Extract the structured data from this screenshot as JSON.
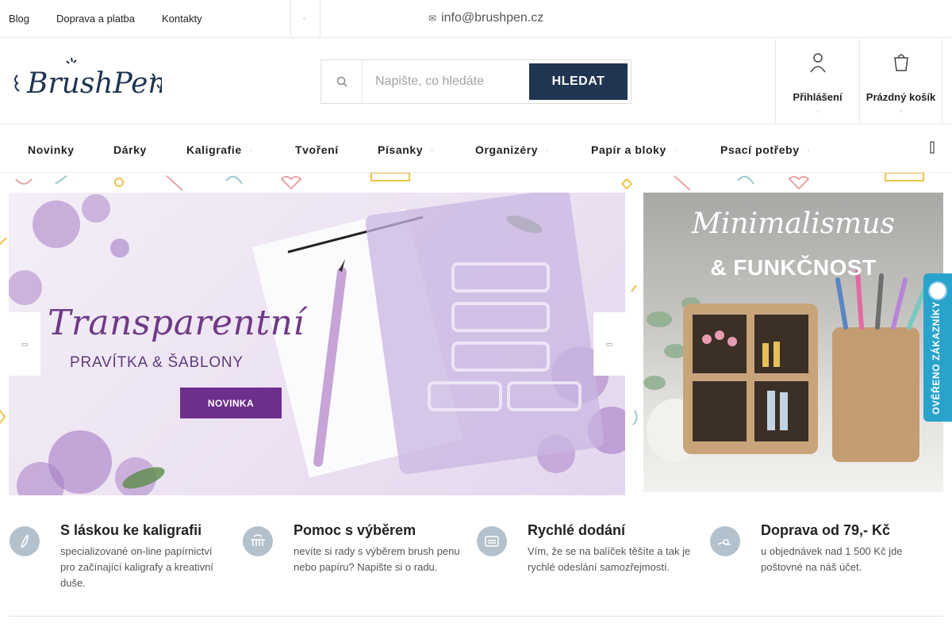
{
  "topbar": {
    "links": [
      "Blog",
      "Doprava a platba",
      "Kontakty"
    ],
    "email": "info@brushpen.cz"
  },
  "header": {
    "logo_text": "BrushPen",
    "search_placeholder": "Napište, co hledáte",
    "search_button": "HLEDAT",
    "login_label": "Přihlášení",
    "cart_label": "Prázdný košík"
  },
  "nav": {
    "items": [
      {
        "label": "Novinky",
        "has_submenu": false
      },
      {
        "label": "Dárky",
        "has_submenu": false
      },
      {
        "label": "Kaligrafie",
        "has_submenu": true
      },
      {
        "label": "Tvoření",
        "has_submenu": false
      },
      {
        "label": "Písanky",
        "has_submenu": true
      },
      {
        "label": "Organizéry",
        "has_submenu": true
      },
      {
        "label": "Papír a bloky",
        "has_submenu": true
      },
      {
        "label": "Psací potřeby",
        "has_submenu": true
      }
    ]
  },
  "banner_main": {
    "title": "Transparentní",
    "subtitle": "PRAVÍTKA & ŠABLONY",
    "button": "NOVINKA"
  },
  "banner_side": {
    "title": "Minimalismus",
    "subtitle": "& FUNKČNOST"
  },
  "badge": {
    "text": "OVĚŘENO ZÁKAZNÍKY"
  },
  "features": [
    {
      "icon": "pen-nib-icon",
      "title": "S láskou ke kaligrafii",
      "text": "specializované on-line papírnictví pro začínající kaligrafy a kreativní duše."
    },
    {
      "icon": "helping-hand-icon",
      "title": "Pomoc s výběrem",
      "text": "nevíte si rady s výběrem brush penu nebo papíru? Napište si o radu."
    },
    {
      "icon": "delivery-truck-icon",
      "title": "Rychlé dodání",
      "text": "Vím, že se na balíček těšíte a tak je rychlé odeslání samozřejmostí."
    },
    {
      "icon": "money-hand-icon",
      "title": "Doprava od 79,- Kč",
      "text": "u objednávek nad 1 500 Kč jde poštovné na náš účet."
    }
  ],
  "colors": {
    "primary_button": "#1f3551",
    "accent_purple": "#6e2f8c",
    "badge_blue": "#2aa3cc",
    "feature_icon_bg": "#b3c1cc"
  }
}
